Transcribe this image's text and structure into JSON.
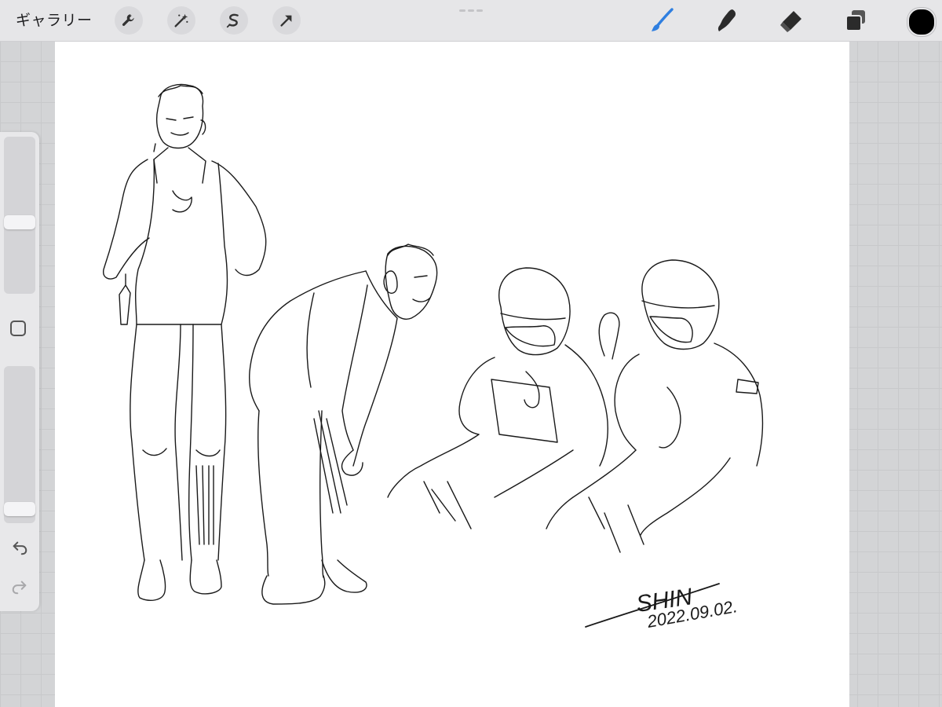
{
  "topbar": {
    "gallery_label": "ギャラリー",
    "left_tools": [
      "wrench-icon",
      "magic-wand-icon",
      "selection-icon",
      "transform-arrow-icon"
    ],
    "right_tools": [
      "brush-icon",
      "smudge-icon",
      "eraser-icon",
      "layers-icon"
    ],
    "active_tool": "brush-icon",
    "accent_color": "#2f7fe0",
    "current_color": "#000000"
  },
  "sidebar": {
    "brush_size": 0.45,
    "opacity": 0.05,
    "undo_icon": "undo-arrow-icon",
    "redo_icon": "redo-arrow-icon"
  },
  "artwork": {
    "signature": "SHIN",
    "date": "2022.09.02."
  }
}
